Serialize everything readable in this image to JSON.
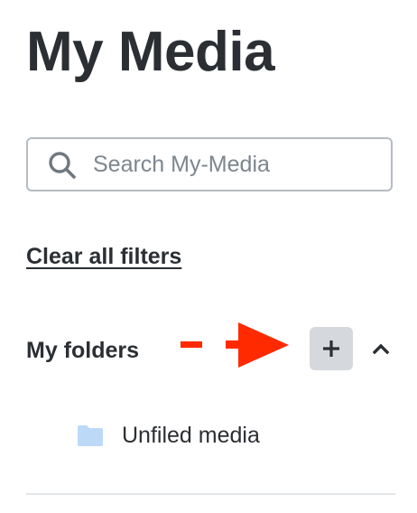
{
  "page": {
    "title": "My Media"
  },
  "search": {
    "placeholder": "Search My-Media",
    "value": ""
  },
  "filters": {
    "clear_label": "Clear all filters"
  },
  "folders": {
    "heading": "My folders",
    "add_icon": "plus-icon",
    "collapse_icon": "chevron-up-icon",
    "items": [
      {
        "label": "Unfiled media",
        "icon": "folder-icon"
      }
    ]
  },
  "annotation": {
    "icon": "red-arrow-icon",
    "color": "#ff2a00"
  },
  "colors": {
    "text": "#2b2f33",
    "placeholder": "#7d868e",
    "search_border": "#b5bcc2",
    "add_button_bg": "#d5d9dd",
    "folder_icon": "#bcd9f8",
    "divider": "#e3e6e9"
  }
}
